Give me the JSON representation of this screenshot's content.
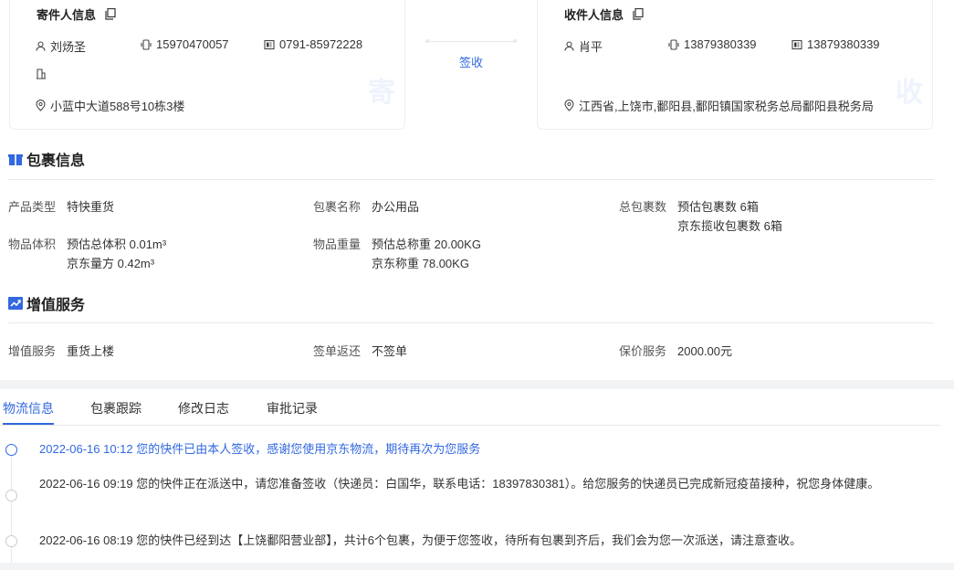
{
  "sender": {
    "title": "寄件人信息",
    "name": "刘炀圣",
    "mobile": "15970470057",
    "phone": "0791-85972228",
    "address": "小蓝中大道588号10栋3楼",
    "badge": "寄"
  },
  "receiver": {
    "title": "收件人信息",
    "name": "肖平",
    "mobile": "13879380339",
    "phone": "13879380339",
    "address": "江西省,上饶市,鄱阳县,鄱阳镇国家税务总局鄱阳县税务局",
    "badge": "收"
  },
  "sign_label": "签收",
  "package": {
    "title": "包裹信息",
    "product_type_label": "产品类型",
    "product_type": "特快重货",
    "name_label": "包裹名称",
    "name": "办公用品",
    "count_label": "总包裹数",
    "count_est": "预估包裹数 6箱",
    "count_jd": "京东揽收包裹数 6箱",
    "volume_label": "物品体积",
    "volume_est": "预估总体积 0.01m³",
    "volume_jd": "京东量方 0.42m³",
    "weight_label": "物品重量",
    "weight_est": "预估总称重 20.00KG",
    "weight_jd": "京东称重 78.00KG"
  },
  "value_added": {
    "title": "增值服务",
    "service_label": "增值服务",
    "service": "重货上楼",
    "return_label": "签单返还",
    "return": "不签单",
    "insure_label": "保价服务",
    "insure": "2000.00元"
  },
  "tabs": [
    {
      "label": "物流信息",
      "active": true
    },
    {
      "label": "包裹跟踪",
      "active": false
    },
    {
      "label": "修改日志",
      "active": false
    },
    {
      "label": "审批记录",
      "active": false
    }
  ],
  "timeline": [
    {
      "text": "2022-06-16 10:12 您的快件已由本人签收，感谢您使用京东物流，期待再次为您服务",
      "active": true
    },
    {
      "text": "2022-06-16 09:19 您的快件正在派送中，请您准备签收（快递员：白国华，联系电话：18397830381）。给您服务的快递员已完成新冠疫苗接种，祝您身体健康。",
      "active": false
    },
    {
      "text": "2022-06-16 08:19 您的快件已经到达【上饶鄱阳营业部】，共计6个包裹，为便于您签收，待所有包裹到齐后，我们会为您一次派送，请注意查收。",
      "active": false
    }
  ],
  "colors": {
    "accent": "#3268e0",
    "text": "#333333",
    "divider": "#e8e8e8"
  }
}
